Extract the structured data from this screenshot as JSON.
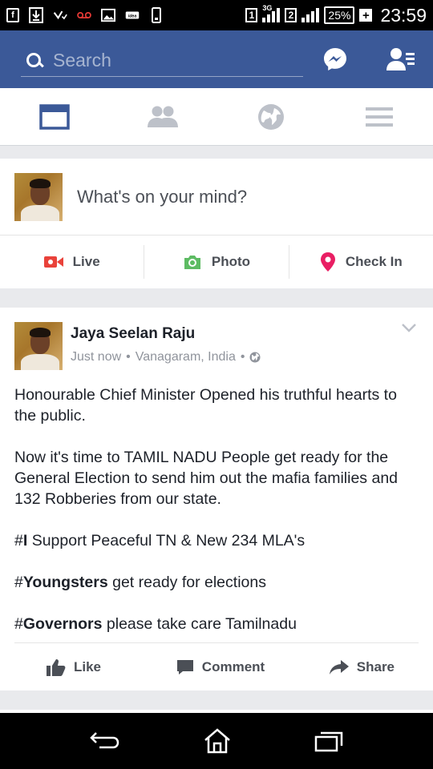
{
  "status_bar": {
    "sim1": "1",
    "sim2": "2",
    "network_type": "3G",
    "battery": "25%",
    "time": "23:59",
    "icons": [
      "facebook-icon",
      "download-icon",
      "check-icon",
      "voicemail-icon",
      "image-icon",
      "idea-app-icon",
      "phone-icon"
    ]
  },
  "header": {
    "search_placeholder": "Search",
    "background_color": "#3b5998"
  },
  "tabs": [
    {
      "name": "news-feed",
      "icon": "news-feed-icon",
      "active": true
    },
    {
      "name": "friends",
      "icon": "friends-icon",
      "active": false
    },
    {
      "name": "notifications",
      "icon": "globe-icon",
      "active": false
    },
    {
      "name": "menu",
      "icon": "hamburger-icon",
      "active": false
    }
  ],
  "composer": {
    "prompt": "What's on your mind?",
    "actions": [
      {
        "label": "Live",
        "icon": "video-camera-icon",
        "color": "#e9423a"
      },
      {
        "label": "Photo",
        "icon": "camera-icon",
        "color": "#5dbb63"
      },
      {
        "label": "Check In",
        "icon": "location-pin-icon",
        "color": "#e91e63"
      }
    ]
  },
  "post": {
    "author": "Jaya Seelan Raju",
    "time": "Just now",
    "location": "Vanagaram, India",
    "paragraphs": [
      {
        "prefix": "",
        "bold": "",
        "text": "Honourable Chief Minister Opened his truthful hearts to the public."
      },
      {
        "prefix": "",
        "bold": "",
        "text": "Now it's time to TAMIL NADU People get ready for the General Election to send him out the mafia families and 132 Robberies from our state."
      },
      {
        "prefix": "#",
        "bold": "I",
        "text": " Support Peaceful TN & New 234 MLA's"
      },
      {
        "prefix": "#",
        "bold": "Youngsters",
        "text": " get ready for elections"
      },
      {
        "prefix": "#",
        "bold": "Governors",
        "text": " please take care Tamilnadu"
      }
    ],
    "actions": [
      {
        "label": "Like",
        "icon": "thumbs-up-icon"
      },
      {
        "label": "Comment",
        "icon": "comment-icon"
      },
      {
        "label": "Share",
        "icon": "share-arrow-icon"
      }
    ]
  },
  "nav_bar": {
    "buttons": [
      "back-icon",
      "home-icon",
      "recents-icon"
    ]
  }
}
